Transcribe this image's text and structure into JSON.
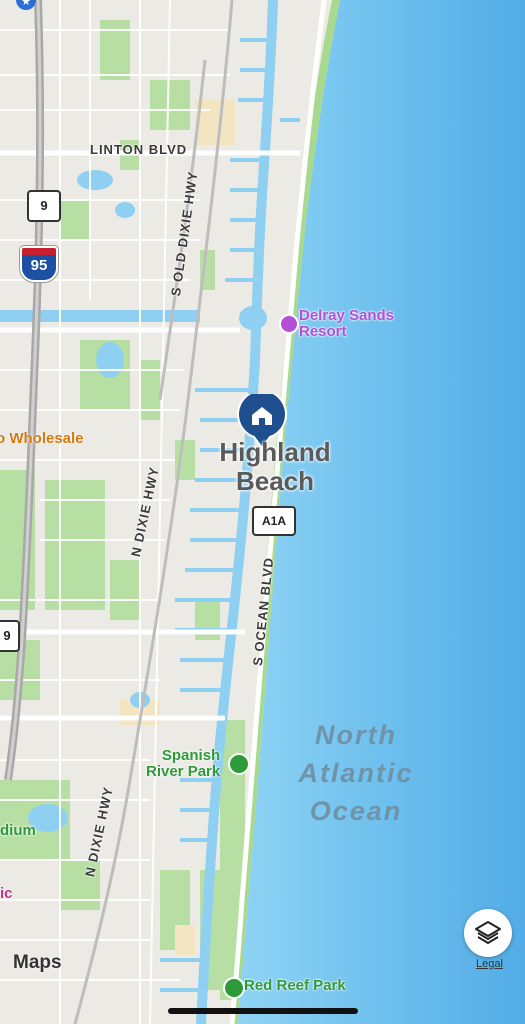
{
  "map": {
    "road_labels": {
      "linton": "LINTON BLVD",
      "old_dixie": "S OLD DIXIE HWY",
      "n_dixie_upper": "N DIXIE HWY",
      "n_dixie_lower": "N DIXIE HWY",
      "ocean_blvd": "S OCEAN BLVD"
    },
    "shields": {
      "state_9_top": "9",
      "state_9_side": "9",
      "interstate": "95",
      "a1a": "A1A"
    },
    "pois": {
      "delray_sands": "Delray Sands\nResort",
      "wholesale": "o Wholesale",
      "spanish_river": "Spanish\nRiver Park",
      "red_reef": "Red Reef Park",
      "stadium": "dium",
      "partial_ic": "ic"
    },
    "place": {
      "city": "Highland\nBeach"
    },
    "water": {
      "ocean": "North\nAtlantic\nOcean"
    }
  },
  "controls": {
    "legal": "Legal",
    "maps_brand": "Maps",
    "layers_icon": "layers-icon"
  },
  "colors": {
    "land": "#eceae4",
    "ocean": "#7cc6ef",
    "ocean_deep": "#5ab0e6",
    "water": "#8fd0f2",
    "park": "#b7dfa4",
    "road": "#ffffff",
    "highway": "#a8a8a8",
    "pin": "#1f4f8f",
    "poi_green": "#2e9a3a",
    "poi_purple": "#b54fd6"
  }
}
